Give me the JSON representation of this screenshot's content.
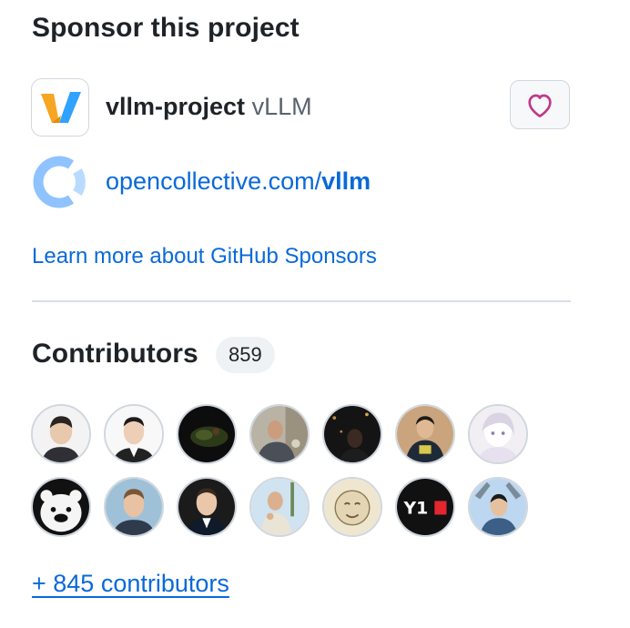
{
  "sponsor": {
    "heading": "Sponsor this project",
    "org": {
      "login": "vllm-project",
      "name": "vLLM",
      "avatar_icon": "vllm-logo"
    },
    "heart_icon": "heart-icon",
    "heart_color": "#bf3989",
    "funding_link": {
      "prefix": "opencollective.com/",
      "handle": "vllm",
      "icon": "opencollective-logo"
    },
    "learn_more": "Learn more about GitHub Sponsors"
  },
  "contributors": {
    "heading": "Contributors",
    "count": "859",
    "more_link": "+ 845 contributors",
    "rows": [
      [
        {
          "icon": "contributor-avatar-1"
        },
        {
          "icon": "contributor-avatar-2"
        },
        {
          "icon": "contributor-avatar-3"
        },
        {
          "icon": "contributor-avatar-4"
        },
        {
          "icon": "contributor-avatar-5"
        },
        {
          "icon": "contributor-avatar-6"
        },
        {
          "icon": "contributor-avatar-7"
        }
      ],
      [
        {
          "icon": "contributor-avatar-8"
        },
        {
          "icon": "contributor-avatar-9"
        },
        {
          "icon": "contributor-avatar-10"
        },
        {
          "icon": "contributor-avatar-11"
        },
        {
          "icon": "contributor-avatar-12"
        },
        {
          "icon": "contributor-avatar-13",
          "text": "Y1"
        },
        {
          "icon": "contributor-avatar-14"
        }
      ]
    ]
  },
  "colors": {
    "link": "#0969da",
    "text": "#1f2328",
    "muted": "#59636e",
    "border": "#d0d7de"
  }
}
